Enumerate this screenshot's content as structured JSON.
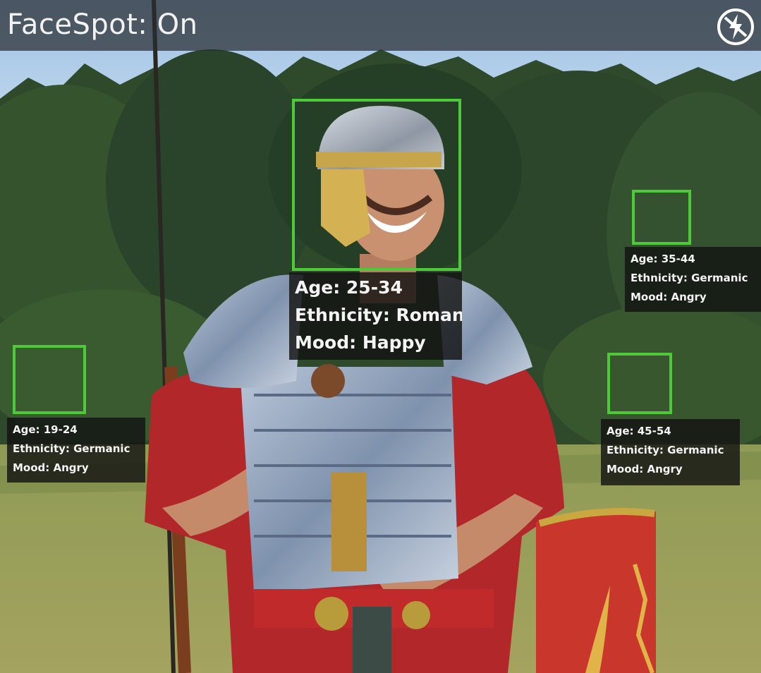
{
  "app": {
    "status_title": "FaceSpot: On",
    "flash_icon": "flash-off-icon"
  },
  "detections": [
    {
      "age": "Age: 25-34",
      "ethnicity": "Ethnicity: Roman",
      "mood": "Mood: Happy"
    },
    {
      "age": "Age: 35-44",
      "ethnicity": "Ethnicity: Germanic",
      "mood": "Mood: Angry"
    },
    {
      "age": "Age: 19-24",
      "ethnicity": "Ethnicity: Germanic",
      "mood": "Mood: Angry"
    },
    {
      "age": "Age: 45-54",
      "ethnicity": "Ethnicity: Germanic",
      "mood": "Mood: Angry"
    }
  ],
  "colors": {
    "detection_box": "#4ec93a",
    "panel_bg": "#121412",
    "topbar_bg": "#282c30"
  }
}
